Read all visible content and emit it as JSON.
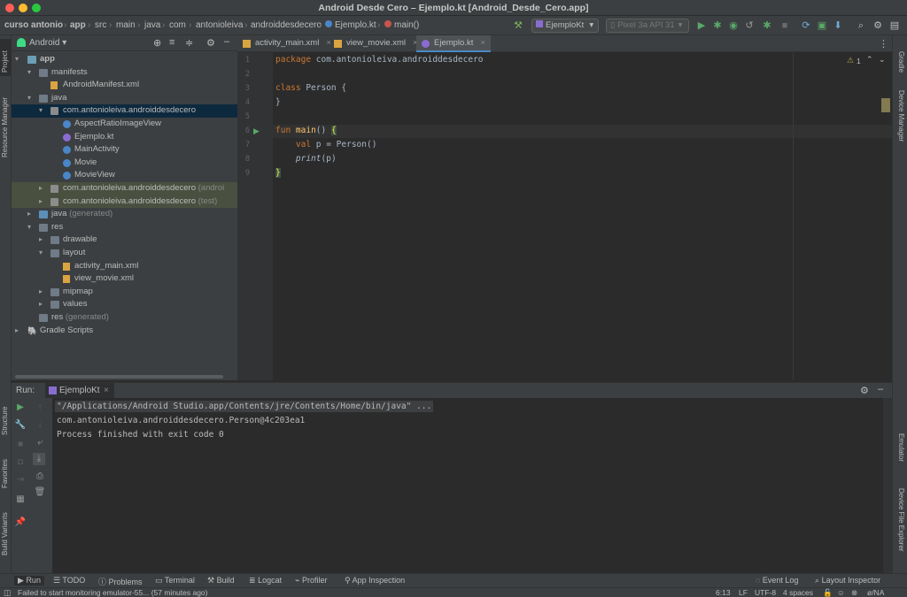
{
  "window": {
    "title": "Android Desde Cero – Ejemplo.kt [Android_Desde_Cero.app]"
  },
  "navbar": {
    "breadcrumbs": [
      "curso antonio",
      "app",
      "src",
      "main",
      "java",
      "com",
      "antonioleiva",
      "androiddesdecero",
      "Ejemplo.kt",
      "main()"
    ],
    "run_config": "EjemploKt",
    "device": "Pixel 3a API 31"
  },
  "left_strip": {
    "project": "Project",
    "resource_manager": "Resource Manager",
    "structure": "Structure",
    "favorites": "Favorites",
    "build_variants": "Build Variants"
  },
  "project_panel": {
    "view": "Android",
    "tree": [
      {
        "label": "app",
        "extra": ""
      },
      {
        "label": "manifests",
        "extra": ""
      },
      {
        "label": "AndroidManifest.xml",
        "extra": ""
      },
      {
        "label": "java",
        "extra": ""
      },
      {
        "label": "com.antonioleiva.androiddesdecero",
        "extra": ""
      },
      {
        "label": "AspectRatioImageView",
        "extra": ""
      },
      {
        "label": "Ejemplo.kt",
        "extra": ""
      },
      {
        "label": "MainActivity",
        "extra": ""
      },
      {
        "label": "Movie",
        "extra": ""
      },
      {
        "label": "MovieView",
        "extra": ""
      },
      {
        "label": "com.antonioleiva.androiddesdecero",
        "extra": "(androi"
      },
      {
        "label": "com.antonioleiva.androiddesdecero",
        "extra": "(test)"
      },
      {
        "label": "java",
        "extra": "(generated)"
      },
      {
        "label": "res",
        "extra": ""
      },
      {
        "label": "drawable",
        "extra": ""
      },
      {
        "label": "layout",
        "extra": ""
      },
      {
        "label": "activity_main.xml",
        "extra": ""
      },
      {
        "label": "view_movie.xml",
        "extra": ""
      },
      {
        "label": "mipmap",
        "extra": ""
      },
      {
        "label": "values",
        "extra": ""
      },
      {
        "label": "res",
        "extra": "(generated)"
      },
      {
        "label": "Gradle Scripts",
        "extra": ""
      }
    ]
  },
  "editor": {
    "tabs": [
      "activity_main.xml",
      "view_movie.xml",
      "Ejemplo.kt"
    ],
    "warnings": "1",
    "line_numbers": [
      "1",
      "2",
      "3",
      "4",
      "5",
      "6",
      "7",
      "8",
      "9"
    ],
    "code": {
      "l1_kw": "package",
      "l1_rest": " com.antonioleiva.androiddesdecero",
      "l3_kw": "class",
      "l3_rest": " Person {",
      "l4": "}",
      "l6_kw": "fun",
      "l6_fn": "main",
      "l6_rest": "() ",
      "l6_brace": "{",
      "l7_kw": "val",
      "l7_rest": " p = Person()",
      "l8_fn": "print",
      "l8_rest": "(p)",
      "l9_brace": "}"
    }
  },
  "right_strip": {
    "gradle": "Gradle",
    "device_manager": "Device Manager",
    "emulator": "Emulator",
    "device_file_explorer": "Device File Explorer"
  },
  "run_panel": {
    "label": "Run:",
    "tab": "EjemploKt",
    "console": [
      "\"/Applications/Android Studio.app/Contents/jre/Contents/Home/bin/java\" ...",
      "com.antonioleiva.androiddesdecero.Person@4c203ea1",
      "Process finished with exit code 0"
    ]
  },
  "bottom_tools": {
    "run": "Run",
    "todo": "TODO",
    "problems": "Problems",
    "terminal": "Terminal",
    "build": "Build",
    "logcat": "Logcat",
    "profiler": "Profiler",
    "app_inspection": "App Inspection",
    "event_log": "Event Log",
    "layout_inspector": "Layout Inspector"
  },
  "status": {
    "message": "Failed to start monitoring emulator-55... (57 minutes ago)",
    "position": "6:13",
    "line_sep": "LF",
    "encoding": "UTF-8",
    "indent": "4 spaces",
    "vcs": "ø/NA"
  }
}
